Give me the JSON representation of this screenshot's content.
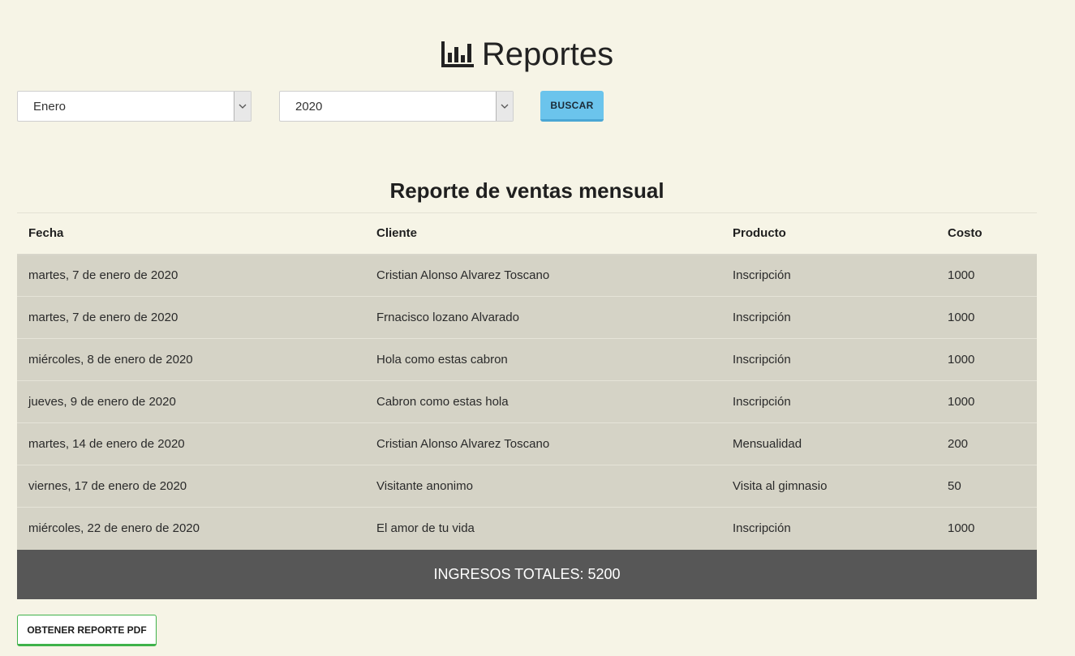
{
  "header": {
    "title": "Reportes",
    "icon": "bar-chart-icon"
  },
  "filters": {
    "month": "Enero",
    "year": "2020",
    "search_label": "BUSCAR"
  },
  "report": {
    "title": "Reporte de ventas mensual",
    "columns": [
      "Fecha",
      "Cliente",
      "Producto",
      "Costo"
    ],
    "rows": [
      [
        "martes, 7 de enero de 2020",
        "Cristian Alonso Alvarez Toscano",
        "Inscripción",
        "1000"
      ],
      [
        "martes, 7 de enero de 2020",
        "Frnacisco lozano Alvarado",
        "Inscripción",
        "1000"
      ],
      [
        "miércoles, 8 de enero de 2020",
        "Hola como estas cabron",
        "Inscripción",
        "1000"
      ],
      [
        "jueves, 9 de enero de 2020",
        "Cabron como estas hola",
        "Inscripción",
        "1000"
      ],
      [
        "martes, 14 de enero de 2020",
        "Cristian Alonso Alvarez Toscano",
        "Mensualidad",
        "200"
      ],
      [
        "viernes, 17 de enero de 2020",
        "Visitante anonimo",
        "Visita al gimnasio",
        "50"
      ],
      [
        "miércoles, 22 de enero de 2020",
        "El amor de tu vida",
        "Inscripción",
        "1000"
      ]
    ],
    "total_label": "INGRESOS TOTALES: 5200"
  },
  "actions": {
    "pdf_label": "OBTENER REPORTE PDF"
  },
  "colors": {
    "background": "#f6f4e6",
    "row_background": "#d5d3c6",
    "total_background": "#575757",
    "search_button": "#6bc4ec",
    "pdf_button_border": "#3fb24a"
  }
}
